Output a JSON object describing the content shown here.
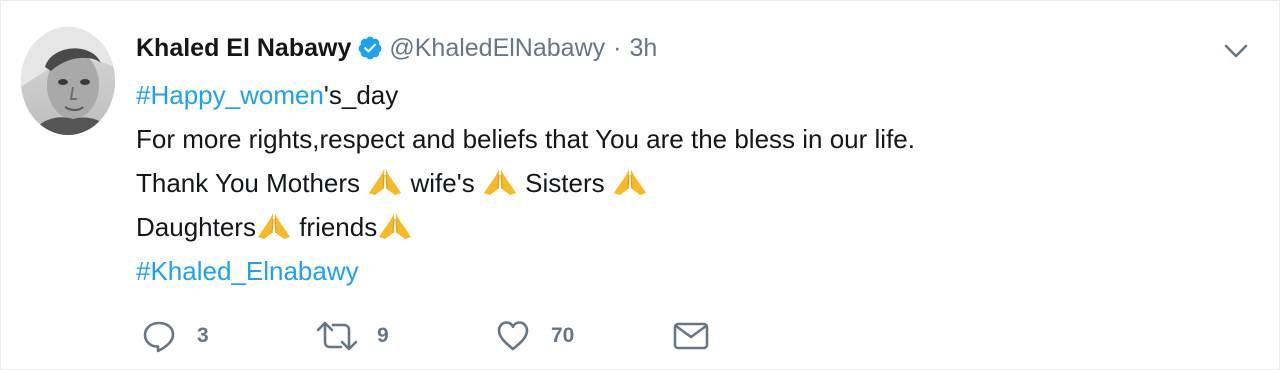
{
  "tweet": {
    "author_name": "Khaled El Nabawy",
    "author_handle": "@KhaledElNabawy",
    "separator": "·",
    "time": "3h",
    "lines": [
      {
        "hashtag": "#Happy_women",
        "text": "'s_day"
      },
      {
        "text": "For more rights,respect and beliefs that You are the bless in our life."
      },
      {
        "seg1": "Thank You Mothers ",
        "seg2": " wife's ",
        "seg3": " Sisters "
      },
      {
        "seg1": "Daughters",
        "seg2": " friends"
      },
      {
        "hashtag": "#Khaled_Elnabawy"
      }
    ],
    "emoji": "folded-hands",
    "actions": {
      "reply_count": "3",
      "retweet_count": "9",
      "like_count": "70",
      "dm_count": ""
    },
    "colors": {
      "link": "#1da1f2",
      "muted": "#657786",
      "text": "#14171a",
      "verified": "#1da1f2",
      "emoji": "#f7b924"
    }
  }
}
